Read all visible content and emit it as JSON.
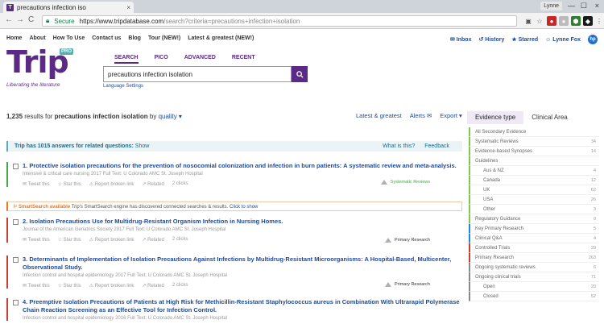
{
  "browser": {
    "tab_title": "precautions infection iso",
    "tab_close": "×",
    "user_chip": "Lynne",
    "secure_label": "Secure",
    "url_host": "https://www.tripdatabase.com",
    "url_rest": "/search?criteria=precautions+infection+isolation",
    "back": "←",
    "forward": "→",
    "reload": "C",
    "minimize": "—",
    "maximize": "☐",
    "close": "×"
  },
  "site_nav": {
    "items": [
      "Home",
      "About",
      "How To Use",
      "Contact us",
      "Blog",
      "Tour (NEW!)",
      "Latest & greatest (NEW!)"
    ]
  },
  "user_nav": {
    "inbox": "Inbox",
    "history": "History",
    "starred": "Starred",
    "user": "Lynne Fox"
  },
  "logo": {
    "word": "Trip",
    "pro": "PRO",
    "tagline": "Liberating the literature"
  },
  "search": {
    "tabs": [
      "SEARCH",
      "PICO",
      "ADVANCED",
      "RECENT"
    ],
    "query": "precautions infection isolation",
    "language_settings": "Language Settings"
  },
  "results_header": {
    "count": "1,235",
    "results_for": "results for",
    "query_bold": "precautions infection isolation",
    "by": "by",
    "sort": "quality ▾",
    "latest": "Latest & greatest",
    "alerts": "Alerts ✉",
    "export": "Export ▾"
  },
  "answers_bar": {
    "lead": "Trip has 1015 answers for related questions:",
    "show": "Show",
    "what_is_this": "What is this?",
    "feedback": "Feedback"
  },
  "smart_search": {
    "label": "⚐ SmartSearch available",
    "message": "Trip's SmartSearch engine has discovered connected searches & results.",
    "link": "Click to show"
  },
  "results": [
    {
      "title": "1. Protective isolation precautions for the prevention of nosocomial colonization and infection in burn patients: A systematic review and meta-analysis.",
      "meta": "Intensive & critical care nursing   2017   Full Text: U Colorado AMC St. Joseph Hospital",
      "tweet": "Tweet this",
      "star": "Star this",
      "report": "Report broken link",
      "related": "Related",
      "clicks": "2 clicks",
      "badge": "Systematic Reviews",
      "color": "#48a548"
    },
    {
      "title": "2. Isolation Precautions Use for Multidrug-Resistant Organism Infection in Nursing Homes.",
      "meta": "Journal of the American Geriatrics Society   2017   Full Text: U Colorado AMC St. Joseph Hospital",
      "tweet": "Tweet this",
      "star": "Star this",
      "report": "Report broken link",
      "related": "Related",
      "clicks": "2 clicks",
      "badge": "Primary Research",
      "color": "#c8402f"
    },
    {
      "title": "3. Determinants of Implementation of Isolation Precautions Against Infections by Multidrug-Resistant Microorganisms: A Hospital-Based, Multicenter, Observational Study.",
      "meta": "Infection control and hospital epidemiology   2017   Full Text: U Colorado AMC St. Joseph Hospital",
      "tweet": "Tweet this",
      "star": "Star this",
      "report": "Report broken link",
      "related": "Related",
      "clicks": "2 clicks",
      "badge": "Primary Research",
      "color": "#c8402f"
    },
    {
      "title": "4. Preemptive Isolation Precautions of Patients at High Risk for Methicillin-Resistant Staphylococcus aureus in Combination With Ultrarapid Polymerase Chain Reaction Screening as an Effective Tool for Infection Control.",
      "meta": "Infection control and hospital epidemiology   2016   Full Text: U Colorado AMC St. Joseph Hospital",
      "color": "#c8402f"
    }
  ],
  "evidence": {
    "tab_active": "Evidence type",
    "tab_other": "Clinical Area",
    "rows": [
      {
        "label": "All Secondary Evidence",
        "count": "",
        "sub": false,
        "color": "#8bc34a"
      },
      {
        "label": "Systematic Reviews",
        "count": "34",
        "sub": false,
        "color": "#8bc34a"
      },
      {
        "label": "Evidence-based Synopses",
        "count": "14",
        "sub": false,
        "color": "#8bc34a"
      },
      {
        "label": "Guidelines",
        "count": "",
        "sub": false,
        "color": "#8bc34a"
      },
      {
        "label": "Aus & NZ",
        "count": "4",
        "sub": true,
        "color": "#8bc34a"
      },
      {
        "label": "Canada",
        "count": "12",
        "sub": true,
        "color": "#8bc34a"
      },
      {
        "label": "UK",
        "count": "62",
        "sub": true,
        "color": "#8bc34a"
      },
      {
        "label": "USA",
        "count": "26",
        "sub": true,
        "color": "#8bc34a"
      },
      {
        "label": "Other",
        "count": "3",
        "sub": true,
        "color": "#8bc34a"
      },
      {
        "label": "Regulatory Guidance",
        "count": "0",
        "sub": false,
        "color": "#8bc34a"
      },
      {
        "label": "Key Primary Research",
        "count": "5",
        "sub": false,
        "color": "#1e88e5"
      },
      {
        "label": "Clinical Q&A",
        "count": "4",
        "sub": false,
        "color": "#1e88e5"
      },
      {
        "label": "Controlled Trials",
        "count": "29",
        "sub": false,
        "color": "#c8402f"
      },
      {
        "label": "Primary Research",
        "count": "263",
        "sub": false,
        "color": "#c8402f"
      },
      {
        "label": "Ongoing systematic reviews",
        "count": "6",
        "sub": false,
        "color": "#888888"
      },
      {
        "label": "Ongoing clinical trials",
        "count": "71",
        "sub": false,
        "color": "#888888"
      },
      {
        "label": "Open",
        "count": "20",
        "sub": true,
        "color": "#888888"
      },
      {
        "label": "Closed",
        "count": "52",
        "sub": true,
        "color": "#888888"
      }
    ]
  }
}
